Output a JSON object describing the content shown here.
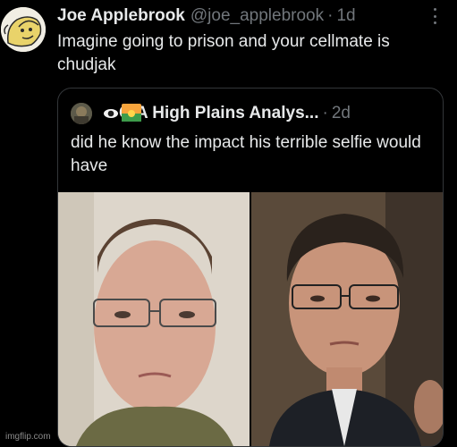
{
  "tweet": {
    "author_name": "Joe Applebrook",
    "handle": "@joe_applebrook",
    "separator": "·",
    "time": "1d",
    "text": "Imagine going to prison and your cellmate is chudjak",
    "avatar_icon": "cartoon-face-avatar-icon",
    "more_icon": "more-options-icon"
  },
  "quoted": {
    "author_name": "CIA High Plains Analys...",
    "separator": "·",
    "time": "2d",
    "text": "did he know the impact his terrible selfie would have",
    "badges": [
      "eye-emoji-icon",
      "sunrise-emoji-icon"
    ],
    "photos": [
      {
        "description_icon": "selfie-photo"
      },
      {
        "description_icon": "courtroom-photo"
      }
    ]
  },
  "watermark": "imgflip.com",
  "colors": {
    "background": "#000000",
    "text_primary": "#e7e9ea",
    "text_secondary": "#71767b",
    "border": "#333639"
  }
}
